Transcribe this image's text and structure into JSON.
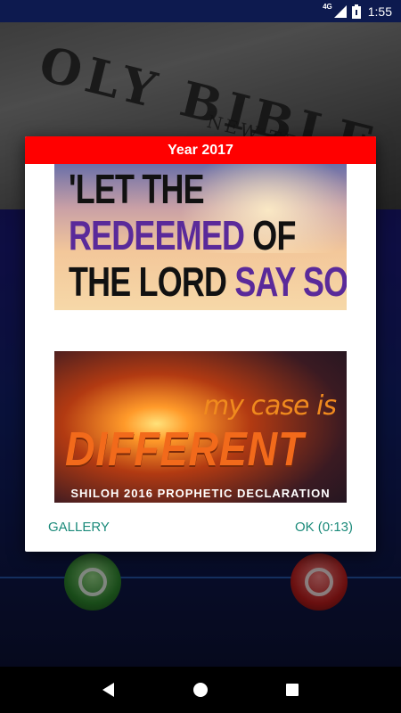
{
  "status_bar": {
    "network": "4G",
    "time": "1:55"
  },
  "background": {
    "photo_text": "OLY BIBLE",
    "photo_subtext": "NEW TESTAM"
  },
  "dialog": {
    "title": "Year 2017",
    "images": [
      {
        "line1": "'LET THE",
        "line2_a": "REDEEMED",
        "line2_b": " OF",
        "line3_a": "THE LORD ",
        "line3_b": "SAY SO'"
      },
      {
        "line1": "my case is",
        "line2": "DIFFERENT",
        "line3": "SHILOH 2016 PROPHETIC DECLARATION"
      }
    ],
    "actions": {
      "gallery_label": "GALLERY",
      "ok_label": "OK (0:13)"
    }
  },
  "nav": {
    "icons": [
      "back-icon",
      "home-icon",
      "recents-icon"
    ]
  },
  "colors": {
    "header": "#ff0000",
    "action_text": "#1b8a7a",
    "status_bar": "#0d1a4f"
  }
}
